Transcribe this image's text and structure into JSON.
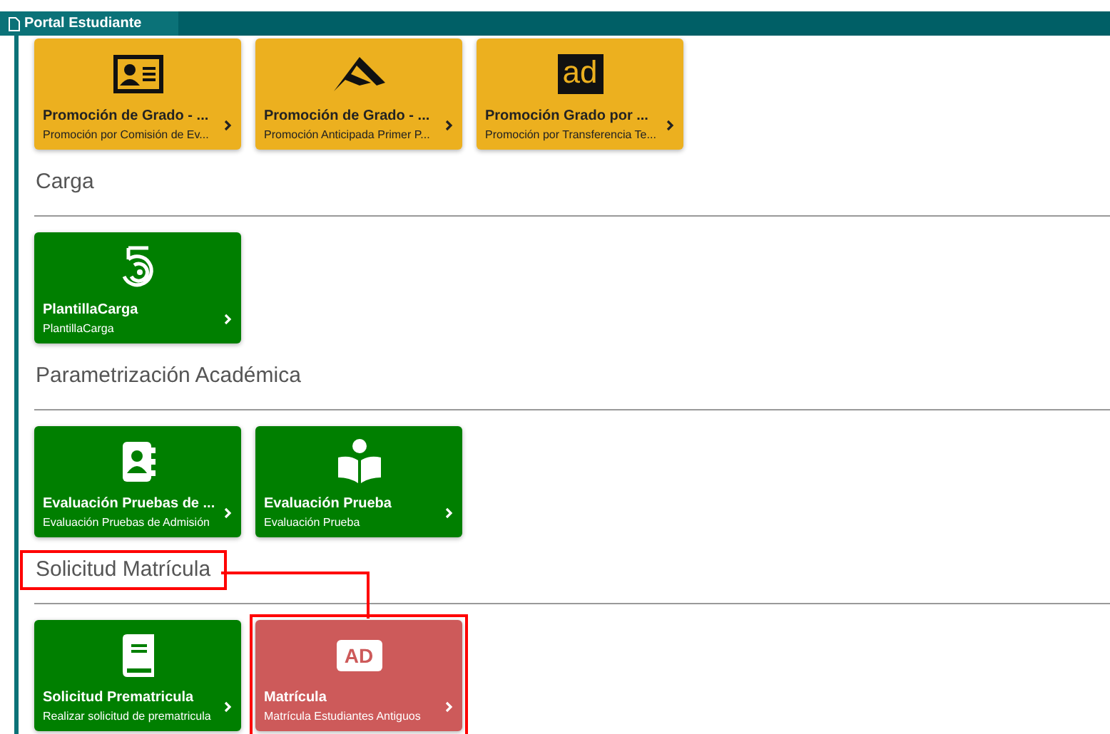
{
  "tab": {
    "title": "Portal Estudiante"
  },
  "top_cards": [
    {
      "kind": "id-card",
      "title": "Promoción de Grado - ...",
      "subtitle": "Promoción por Comisión de Ev...",
      "color": "#ecb01f",
      "highlighted": false
    },
    {
      "kind": "fold",
      "title": "Promoción de Grado - ...",
      "subtitle": "Promoción Anticipada Primer P...",
      "color": "#ecb01f",
      "highlighted": false
    },
    {
      "kind": "badge",
      "icon_text": "ad",
      "title": "Promoción Grado por ...",
      "subtitle": "Promoción por Transferencia Te...",
      "color": "#ecb01f",
      "highlighted": false
    }
  ],
  "sections": [
    {
      "heading": "Carga",
      "highlighted": false,
      "cards": [
        {
          "kind": "spiral",
          "title": "PlantillaCarga",
          "subtitle": "PlantillaCarga",
          "color": "#007f00",
          "highlighted": false
        }
      ]
    },
    {
      "heading": "Parametrización Académica",
      "highlighted": false,
      "cards": [
        {
          "kind": "contacts",
          "title": "Evaluación Pruebas de ...",
          "subtitle": "Evaluación Pruebas de Admisión",
          "color": "#007f00",
          "highlighted": false
        },
        {
          "kind": "reader",
          "title": "Evaluación Prueba",
          "subtitle": "Evaluación Prueba",
          "color": "#007f00",
          "highlighted": false
        }
      ]
    },
    {
      "heading": "Solicitud Matrícula",
      "highlighted": true,
      "cards": [
        {
          "kind": "book",
          "title": "Solicitud Prematricula",
          "subtitle": "Realizar solicitud de prematricula",
          "color": "#007f00",
          "highlighted": false
        },
        {
          "kind": "label",
          "icon_text": "AD",
          "title": "Matrícula",
          "subtitle": "Matrícula Estudiantes Antiguos",
          "color": "#cd5a5a",
          "highlighted": true
        }
      ]
    }
  ]
}
